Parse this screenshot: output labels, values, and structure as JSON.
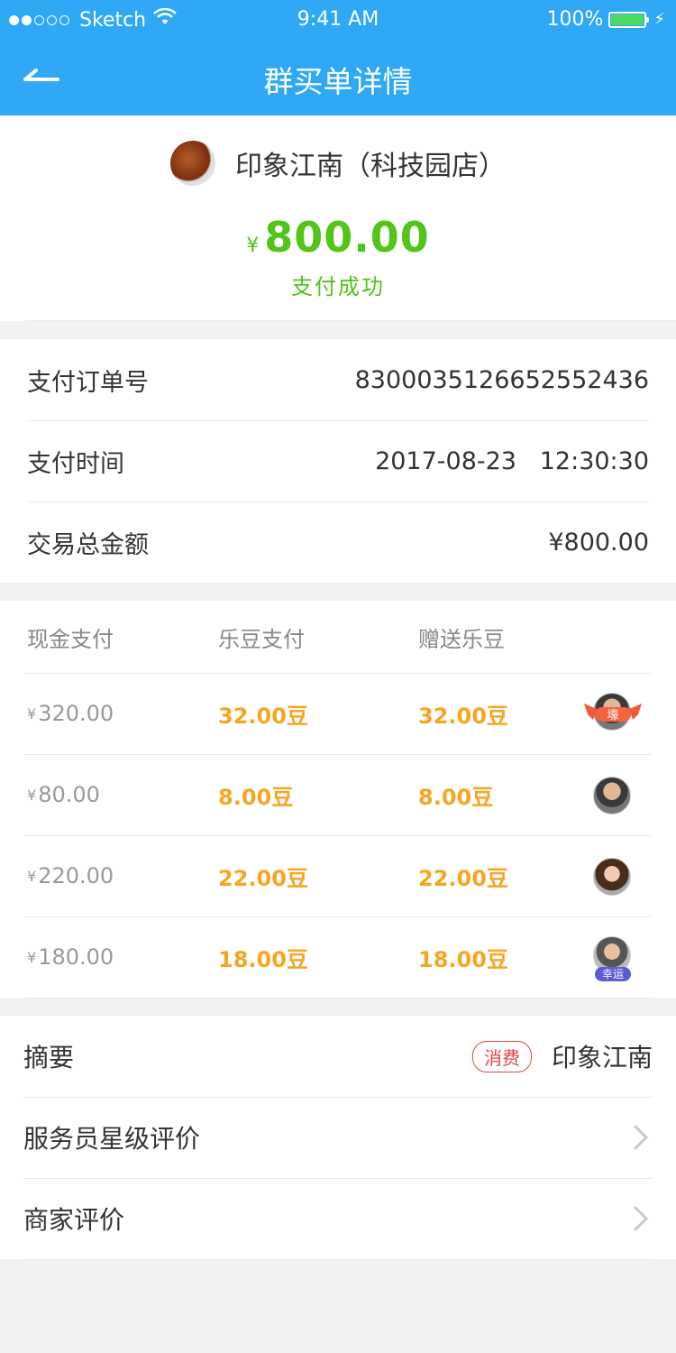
{
  "status_bar": {
    "carrier": "Sketch",
    "time": "9:41 AM",
    "battery": "100%"
  },
  "nav": {
    "title": "群买单详情"
  },
  "shop": {
    "name": "印象江南（科技园店）",
    "currency": "¥",
    "amount": "800.00",
    "status": "支付成功"
  },
  "info": [
    {
      "label": "支付订单号",
      "value": "830003512665255243​6"
    },
    {
      "label": "支付时间",
      "value": "2017-08-23   12:30:30"
    },
    {
      "label": "交易总金额",
      "value": "¥800.00"
    }
  ],
  "payments": {
    "headers": [
      "现金支付",
      "乐豆支付",
      "赠送乐豆"
    ],
    "rows": [
      {
        "cash_cur": "¥",
        "cash": "320.00",
        "bean_pay": "32.00豆",
        "bean_gift": "32.00豆",
        "badge": "壕"
      },
      {
        "cash_cur": "¥",
        "cash": "80.00",
        "bean_pay": "8.00豆",
        "bean_gift": "8.00豆"
      },
      {
        "cash_cur": "¥",
        "cash": "220.00",
        "bean_pay": "22.00豆",
        "bean_gift": "22.00豆"
      },
      {
        "cash_cur": "¥",
        "cash": "180.00",
        "bean_pay": "18.00豆",
        "bean_gift": "18.00豆",
        "badge": "幸运"
      }
    ]
  },
  "summary": {
    "abstract_label": "摘要",
    "abstract_tag": "消费",
    "abstract_value": "印象江南",
    "waiter_rating_label": "服务员星级评价",
    "merchant_rating_label": "商家评价"
  },
  "colors": {
    "header": "#2fa8f5",
    "success_green": "#52c41a",
    "bean_orange": "#f5a623",
    "tag_red": "#e64545"
  }
}
